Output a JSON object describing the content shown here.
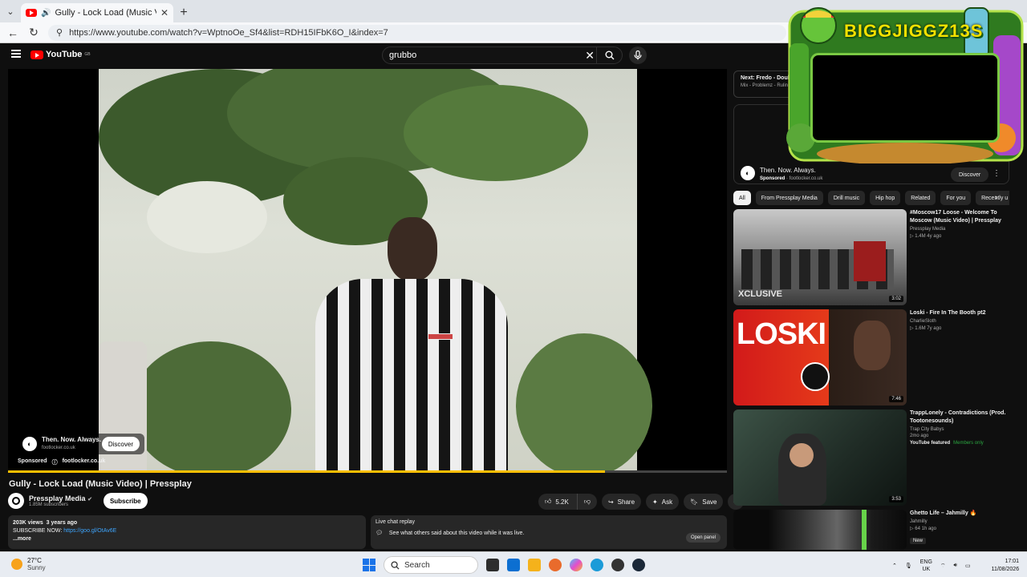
{
  "browser": {
    "tab_title": "Gully - Lock Load (Music Vide",
    "url": "https://www.youtube.com/watch?v=WptnoOe_Sf4&list=RDH15IFbK6O_I&index=7"
  },
  "youtube": {
    "logo_text": "YouTube",
    "region": "GB",
    "search_value": "grubbo"
  },
  "player": {
    "ad_title": "Then. Now. Always.",
    "ad_domain": "footlocker.co.uk",
    "ad_button": "Discover",
    "sponsored": "Sponsored",
    "sponsored_domain": "footlocker.co.uk",
    "progress_fraction": 0.83
  },
  "video": {
    "title": "Gully - Lock Load (Music Video) | Pressplay",
    "channel": "Pressplay Media",
    "subscribers": "1.85M subscribers",
    "subscribe_label": "Subscribe",
    "likes": "5.2K",
    "share_label": "Share",
    "ask_label": "Ask",
    "save_label": "Save",
    "views": "203K views",
    "age": "3 years ago",
    "desc_prefix": "SUBSCRIBE NOW:",
    "desc_link": "https://goo.gl/OtAv6E",
    "more_label": "...more"
  },
  "chat": {
    "title": "Live chat replay",
    "text": "See what others said about this video while it was live.",
    "button": "Open panel"
  },
  "sidebar": {
    "next_label": "Next: Fredo - Doub",
    "next_sub": "Mix - Problemz - Rulin",
    "ad_title": "Then. Now. Always.",
    "ad_sponsored": "Sponsored",
    "ad_domain": "· footlocker.co.uk",
    "ad_button": "Discover",
    "chips": [
      "All",
      "From Pressplay Media",
      "Drill music",
      "Hip hop",
      "Related",
      "For you",
      "Recently u"
    ],
    "recs": [
      {
        "title": "#Moscow17 Loose - Welcome To Moscow (Music Video) | Pressplay",
        "channel": "Pressplay Media",
        "stats": "▷ 1.4M  4y ago",
        "duration": "3:02",
        "thumb_text": "XCLUSIVE"
      },
      {
        "title": "Loski - Fire In The Booth pt2",
        "channel": "CharlieSloth",
        "stats": "▷ 1.6M  7y ago",
        "duration": "7:46",
        "thumb_text": "LOSKI"
      },
      {
        "title": "TrappLonely - Contradictions (Prod. Tootonesounds)",
        "channel": "Trap City Babys",
        "stats": "2mo ago",
        "duration": "3:53",
        "featured": "YouTube featured",
        "members": "Members only"
      },
      {
        "title": "Ghetto Life – Jahmilly 🔥",
        "channel": "Jahmilly",
        "stats": "▷ 64  1h ago",
        "tag": "New"
      }
    ]
  },
  "overlay": {
    "title": "BIGGJIGGZ13S"
  },
  "taskbar": {
    "temp": "27°C",
    "weather": "Sunny",
    "search": "Search",
    "lang1": "ENG",
    "lang2": "UK",
    "time": "17:01",
    "date": "11/08/2026"
  },
  "colors": {
    "accent_red": "#ff0000",
    "progress": "#ffbf00",
    "link": "#3ea6ff",
    "member_green": "#2ba640"
  }
}
